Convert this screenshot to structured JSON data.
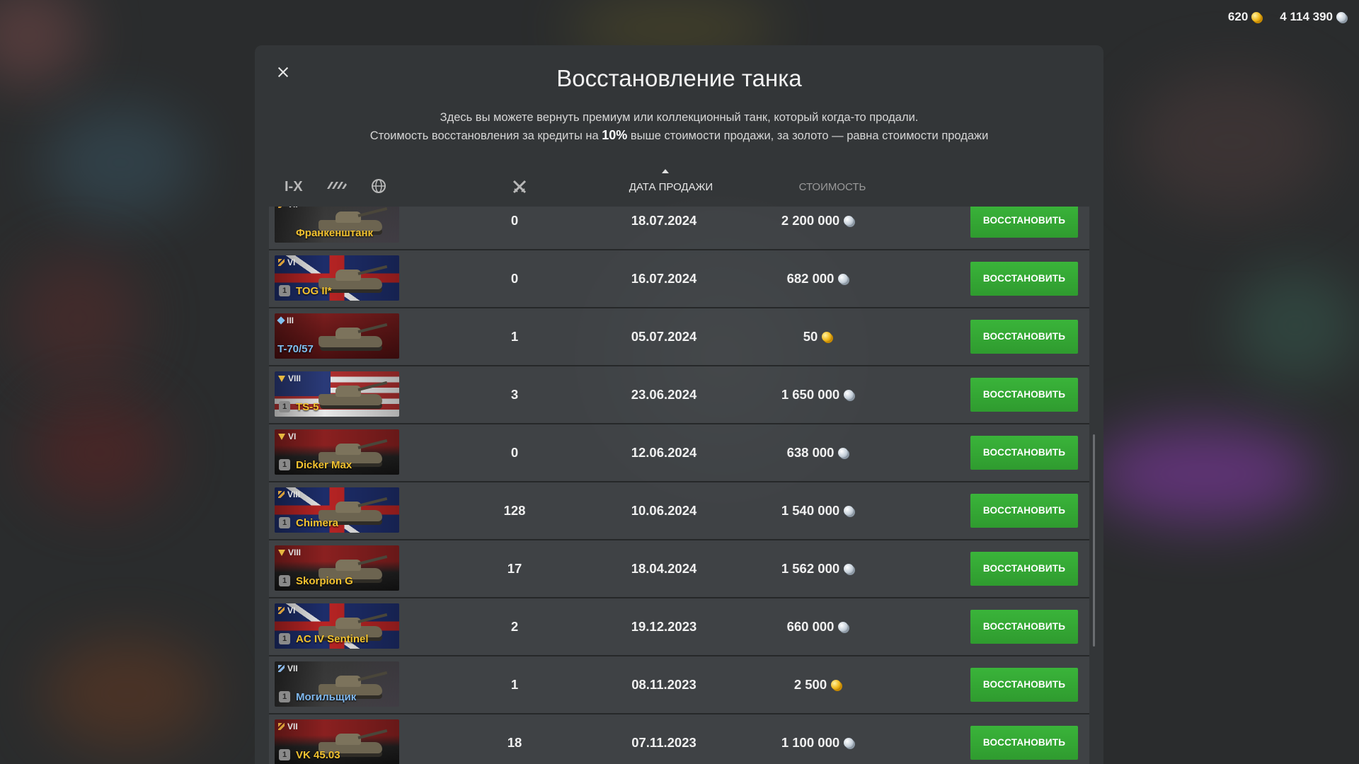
{
  "currency": {
    "gold": "620",
    "credits": "4 114 390"
  },
  "dialog": {
    "title": "Восстановление танка",
    "line1": "Здесь вы можете вернуть премиум или коллекционный танк, который когда-то продали.",
    "line2_a": "Стоимость восстановления за кредиты на",
    "line2_pct": "10%",
    "line2_b": "выше стоимости продажи, за золото — равна стоимости продажи"
  },
  "header": {
    "tier_filter": "I-X",
    "type_filter_icon": "tank-type-icon",
    "nation_filter_icon": "globe-icon",
    "battles_icon": "crossed-swords-icon",
    "date_label": "ДАТА ПРОДАЖИ",
    "cost_label": "СТОИМОСТЬ",
    "sort": "date-desc"
  },
  "restore_label": "ВОССТАНОВИТЬ",
  "rows": [
    {
      "name": "Франкенштанк",
      "tier": "VII",
      "class_icon": "premium",
      "flag": "mixed",
      "battles": "0",
      "date": "18.07.2024",
      "cost": "2 200 000",
      "currency": "credits",
      "mastery": ""
    },
    {
      "name": "TOG II*",
      "tier": "VI",
      "class_icon": "premium",
      "flag": "uk",
      "battles": "0",
      "date": "16.07.2024",
      "cost": "682 000",
      "currency": "credits",
      "mastery": "1"
    },
    {
      "name": "T-70/57",
      "tier": "III",
      "class_icon": "light",
      "flag": "ussr",
      "battles": "1",
      "date": "05.07.2024",
      "cost": "50",
      "currency": "gold",
      "mastery": ""
    },
    {
      "name": "TS-5",
      "tier": "VIII",
      "class_icon": "td",
      "flag": "usa",
      "battles": "3",
      "date": "23.06.2024",
      "cost": "1 650 000",
      "currency": "credits",
      "mastery": "1"
    },
    {
      "name": "Dicker Max",
      "tier": "VI",
      "class_icon": "td",
      "flag": "germany",
      "battles": "0",
      "date": "12.06.2024",
      "cost": "638 000",
      "currency": "credits",
      "mastery": "1"
    },
    {
      "name": "Chimera",
      "tier": "VIII",
      "class_icon": "premium",
      "flag": "uk",
      "battles": "128",
      "date": "10.06.2024",
      "cost": "1 540 000",
      "currency": "credits",
      "mastery": "1"
    },
    {
      "name": "Skorpion G",
      "tier": "VIII",
      "class_icon": "td",
      "flag": "germany",
      "battles": "17",
      "date": "18.04.2024",
      "cost": "1 562 000",
      "currency": "credits",
      "mastery": "1"
    },
    {
      "name": "AC IV Sentinel",
      "tier": "VI",
      "class_icon": "premium",
      "flag": "uk",
      "battles": "2",
      "date": "19.12.2023",
      "cost": "660 000",
      "currency": "credits",
      "mastery": "1"
    },
    {
      "name": "Могильщик",
      "tier": "VII",
      "class_icon": "collect",
      "flag": "mixed",
      "battles": "1",
      "date": "08.11.2023",
      "cost": "2 500",
      "currency": "gold",
      "mastery": "1"
    },
    {
      "name": "VK 45.03",
      "tier": "VII",
      "class_icon": "premium",
      "flag": "germany",
      "battles": "18",
      "date": "07.11.2023",
      "cost": "1 100 000",
      "currency": "credits",
      "mastery": "1"
    }
  ],
  "colors": {
    "accent_green": "#35a835",
    "premium_name": "#f2c230",
    "collector_name": "#7fb8ee"
  }
}
